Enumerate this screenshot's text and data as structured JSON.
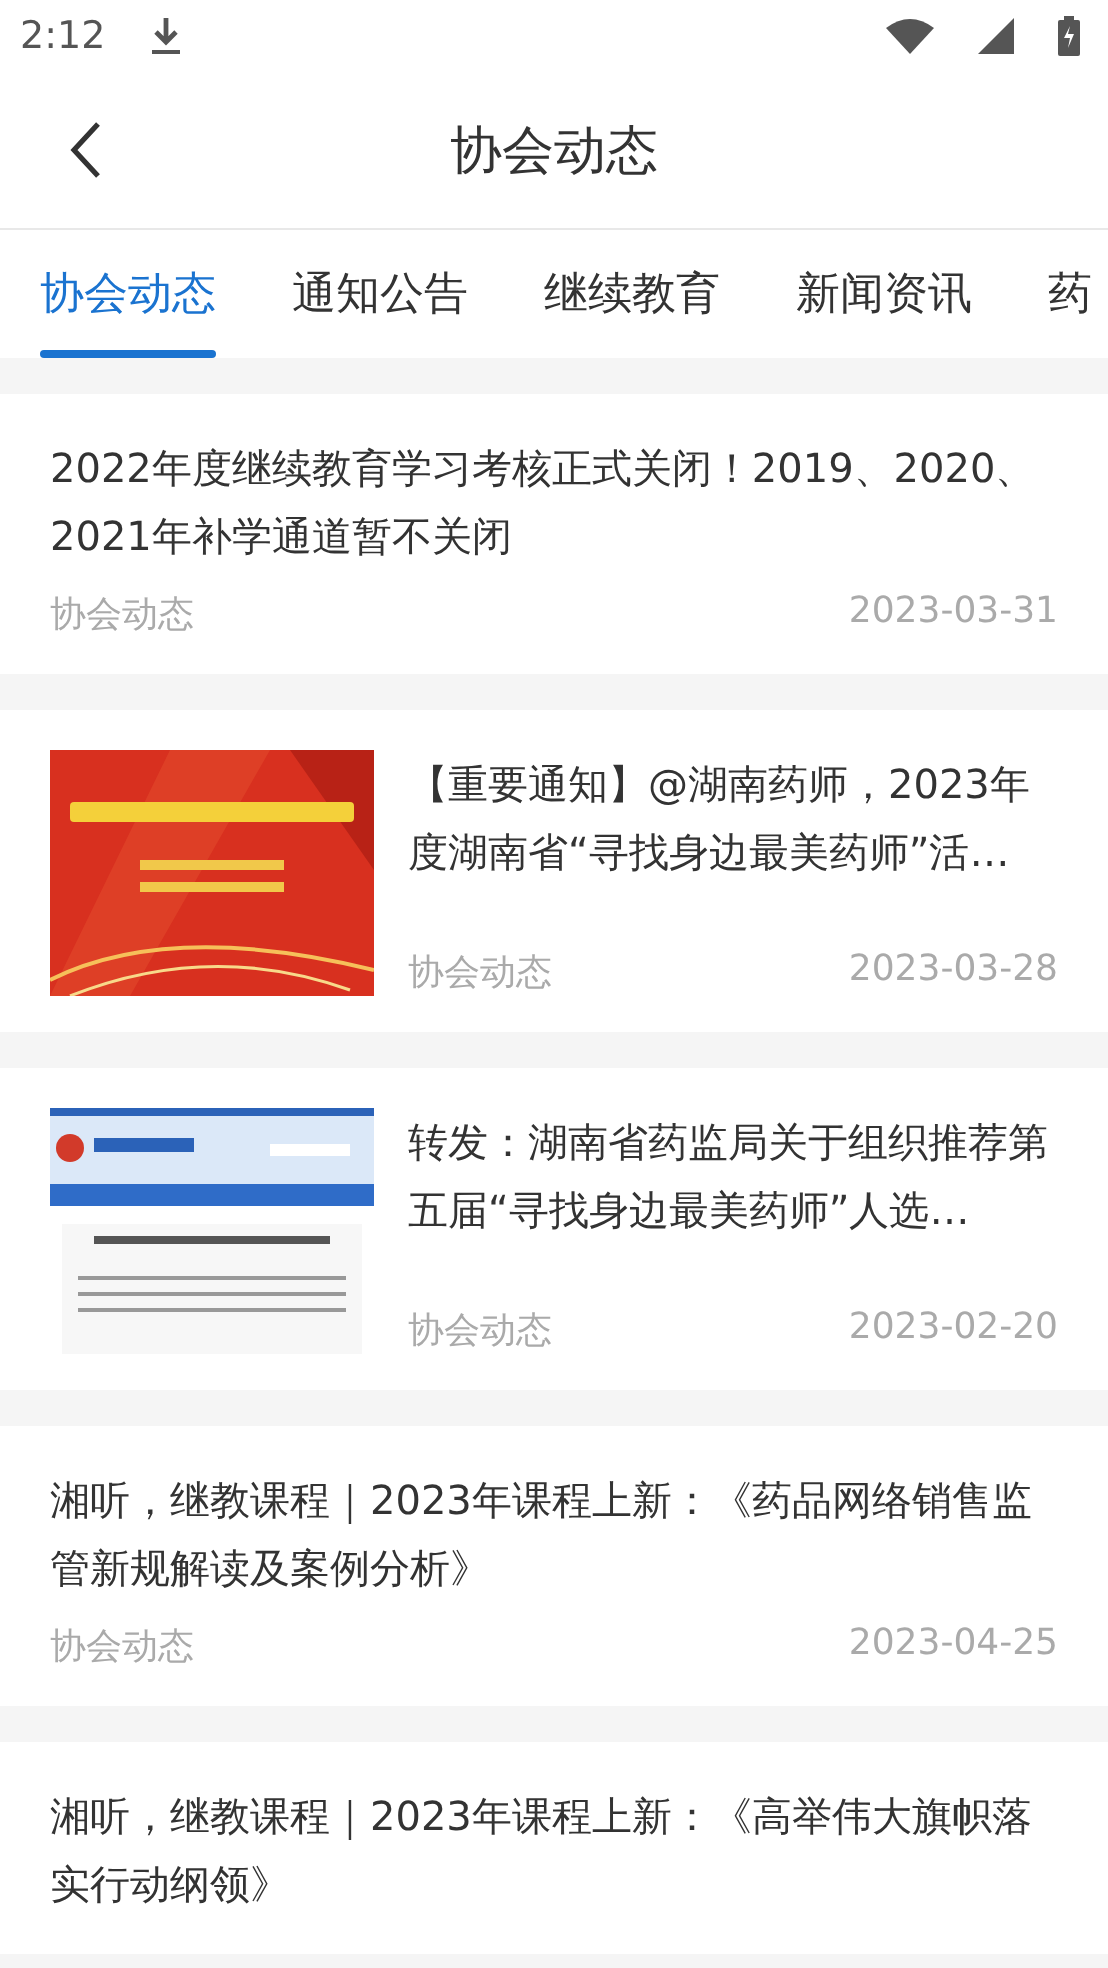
{
  "status_bar": {
    "time": "2:12"
  },
  "header": {
    "title": "协会动态"
  },
  "tabs": [
    {
      "label": "协会动态",
      "selected": true
    },
    {
      "label": "通知公告",
      "selected": false
    },
    {
      "label": "继续教育",
      "selected": false
    },
    {
      "label": "新闻资讯",
      "selected": false
    },
    {
      "label": "药",
      "selected": false
    }
  ],
  "articles": [
    {
      "kind": "text",
      "title": "2022年度继续教育学习考核正式关闭！2019、2020、2021年补学通道暂不关闭",
      "category": "协会动态",
      "date": "2023-03-31"
    },
    {
      "kind": "thumbnail",
      "title": "【重要通知】@湖南药师，2023年度湖南省“寻找身边最美药师”活…",
      "category": "协会动态",
      "date": "2023-03-28"
    },
    {
      "kind": "thumbnail",
      "title": "转发：湖南省药监局关于组织推荐第五届“寻找身边最美药师”人选…",
      "category": "协会动态",
      "date": "2023-02-20"
    },
    {
      "kind": "text",
      "title": "湘听，继教课程｜2023年课程上新：《药品网络销售监管新规解读及案例分析》",
      "category": "协会动态",
      "date": "2023-04-25"
    },
    {
      "kind": "text",
      "title": "湘听，继教课程｜2023年课程上新：《高举伟大旗帜落实行动纲领》"
    }
  ]
}
